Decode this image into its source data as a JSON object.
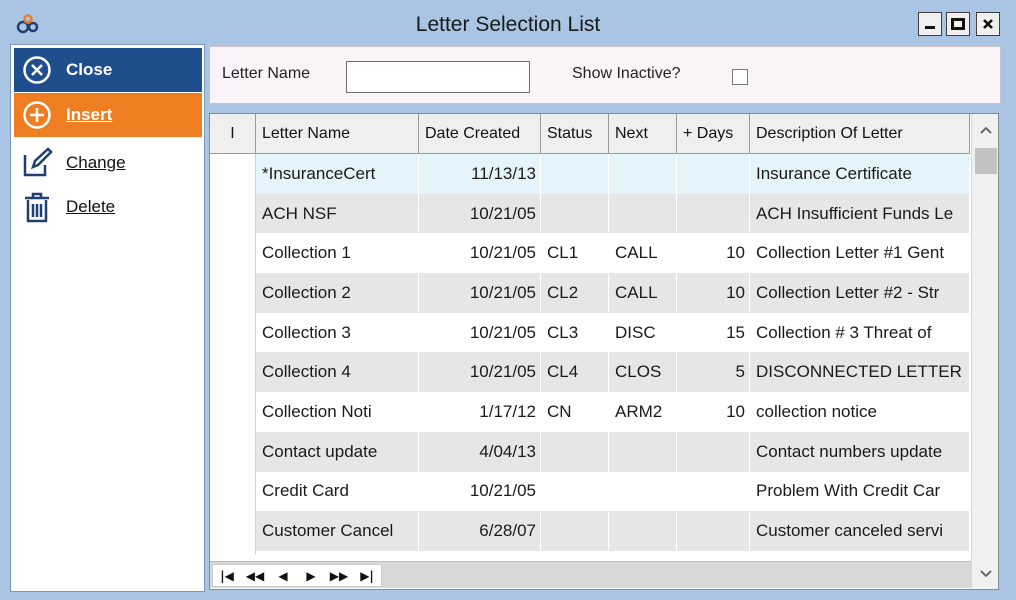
{
  "window": {
    "title": "Letter Selection List",
    "app_icon": "gears-icon"
  },
  "sidebar": {
    "close_label": "Close",
    "insert_label": "Insert",
    "change_label": "Change",
    "delete_label": "Delete"
  },
  "filter": {
    "letter_name_label": "Letter Name",
    "letter_name_value": "",
    "show_inactive_label": "Show Inactive?",
    "show_inactive_checked": false
  },
  "grid": {
    "columns": [
      "I",
      "Letter Name",
      "Date Created",
      "Status",
      "Next",
      "+ Days",
      "Description Of Letter"
    ],
    "rows": [
      {
        "indicator": "",
        "name": "*InsuranceCert",
        "date": "11/13/13",
        "status": "",
        "next": "",
        "days": "",
        "desc": "Insurance Certificate"
      },
      {
        "indicator": "",
        "name": "ACH NSF",
        "date": "10/21/05",
        "status": "",
        "next": "",
        "days": "",
        "desc": "ACH Insufficient Funds Le"
      },
      {
        "indicator": "",
        "name": "Collection 1",
        "date": "10/21/05",
        "status": "CL1",
        "next": "CALL",
        "days": "10",
        "desc": "Collection Letter #1 Gent"
      },
      {
        "indicator": "",
        "name": "Collection 2",
        "date": "10/21/05",
        "status": "CL2",
        "next": "CALL",
        "days": "10",
        "desc": "Collection Letter #2 - Str"
      },
      {
        "indicator": "",
        "name": "Collection 3",
        "date": "10/21/05",
        "status": "CL3",
        "next": "DISC",
        "days": "15",
        "desc": "Collection # 3 Threat of"
      },
      {
        "indicator": "",
        "name": "Collection 4",
        "date": "10/21/05",
        "status": "CL4",
        "next": "CLOS",
        "days": "5",
        "desc": "DISCONNECTED LETTER"
      },
      {
        "indicator": "",
        "name": "Collection Noti",
        "date": "1/17/12",
        "status": "CN",
        "next": "ARM2",
        "days": "10",
        "desc": "collection notice"
      },
      {
        "indicator": "",
        "name": "Contact update",
        "date": "4/04/13",
        "status": "",
        "next": "",
        "days": "",
        "desc": "Contact numbers update"
      },
      {
        "indicator": "",
        "name": "Credit Card",
        "date": "10/21/05",
        "status": "",
        "next": "",
        "days": "",
        "desc": "Problem With Credit Car"
      },
      {
        "indicator": "",
        "name": "Customer Cancel",
        "date": "6/28/07",
        "status": "",
        "next": "",
        "days": "",
        "desc": "Customer canceled servi"
      },
      {
        "indicator": "",
        "name": "",
        "date": "",
        "status": "",
        "next": "",
        "days": "",
        "desc": ""
      }
    ],
    "navigator": [
      "|◀",
      "◀◀",
      "◀",
      "▶",
      "▶▶",
      "▶|"
    ]
  }
}
